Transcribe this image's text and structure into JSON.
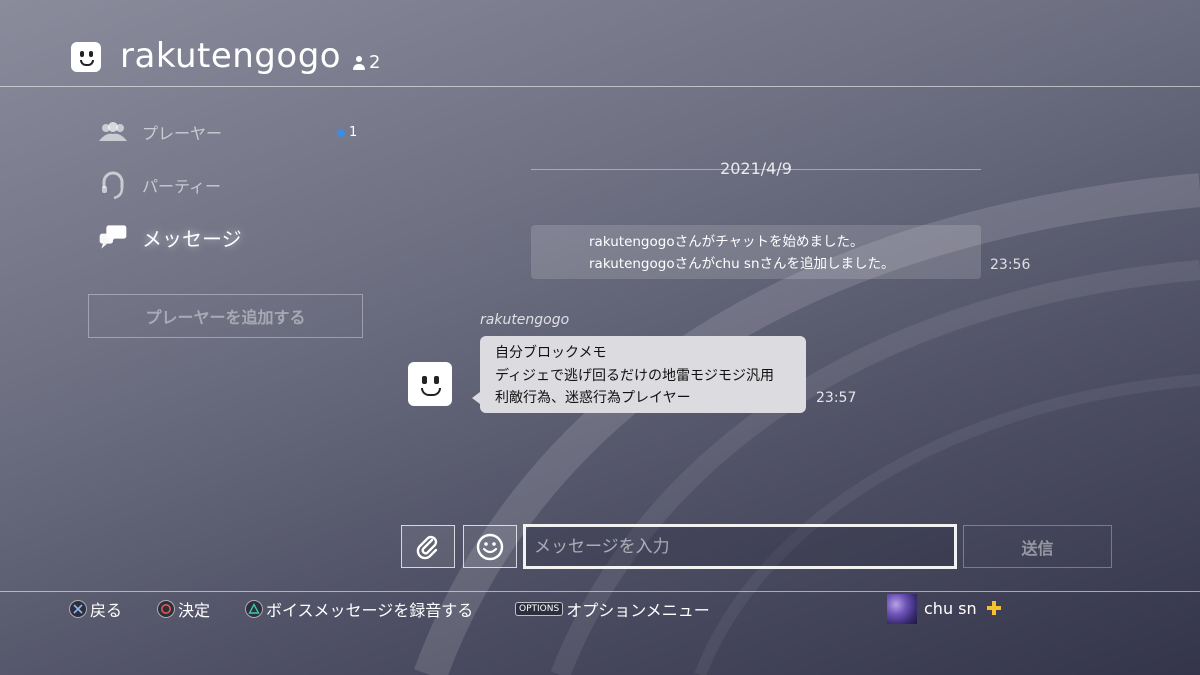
{
  "header": {
    "title": "rakutengogo",
    "member_count": "2"
  },
  "sidebar": {
    "items": [
      {
        "label": "プレーヤー",
        "icon": "players-icon",
        "badge": "1"
      },
      {
        "label": "パーティー",
        "icon": "headset-icon"
      },
      {
        "label": "メッセージ",
        "icon": "messages-icon",
        "active": true
      }
    ],
    "add_player_label": "プレーヤーを追加する"
  },
  "chat": {
    "date": "2021/4/9",
    "system_messages": [
      "rakutengogoさんがチャットを始めました。",
      "rakutengogoさんがchu snさんを追加しました。"
    ],
    "system_time": "23:56",
    "messages": [
      {
        "sender": "rakutengogo",
        "lines": [
          "自分ブロックメモ",
          "ディジェで逃げ回るだけの地雷モジモジ汎用",
          "利敵行為、迷惑行為プレイヤー"
        ],
        "time": "23:57"
      }
    ]
  },
  "input_bar": {
    "placeholder": "メッセージを入力",
    "send_label": "送信"
  },
  "footer": {
    "hints": [
      {
        "button": "cross",
        "label": "戻る"
      },
      {
        "button": "circle",
        "label": "決定"
      },
      {
        "button": "triangle",
        "label": "ボイスメッセージを録音する"
      },
      {
        "button": "OPTIONS",
        "label": "オプションメニュー"
      }
    ],
    "user_name": "chu sn"
  },
  "colors": {
    "badge_dot": "#3b8ee8",
    "plus_gold": "#f2c230",
    "circle_button": "#e05a4a",
    "triangle_button": "#3fc8a8"
  }
}
